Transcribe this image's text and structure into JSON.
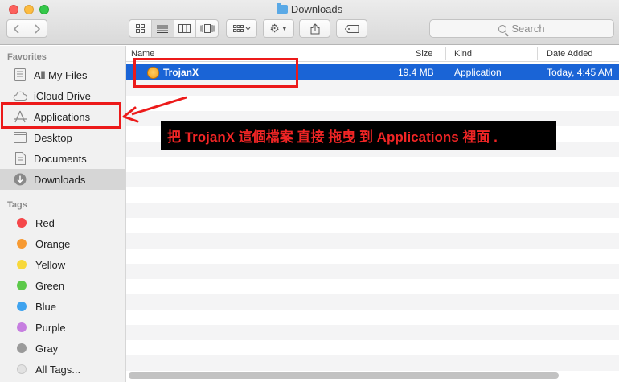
{
  "window": {
    "title": "Downloads"
  },
  "toolbar": {
    "search_placeholder": "Search"
  },
  "sidebar": {
    "favorites_header": "Favorites",
    "favorites": [
      {
        "label": "All My Files",
        "icon": "all-files-icon"
      },
      {
        "label": "iCloud Drive",
        "icon": "cloud-icon"
      },
      {
        "label": "Applications",
        "icon": "applications-icon"
      },
      {
        "label": "Desktop",
        "icon": "desktop-icon"
      },
      {
        "label": "Documents",
        "icon": "documents-icon"
      },
      {
        "label": "Downloads",
        "icon": "downloads-icon",
        "selected": true
      }
    ],
    "tags_header": "Tags",
    "tags": [
      {
        "label": "Red",
        "color": "#f5474a"
      },
      {
        "label": "Orange",
        "color": "#f79a32"
      },
      {
        "label": "Yellow",
        "color": "#f7d83b"
      },
      {
        "label": "Green",
        "color": "#5cc94a"
      },
      {
        "label": "Blue",
        "color": "#3fa3ef"
      },
      {
        "label": "Purple",
        "color": "#c67ee0"
      },
      {
        "label": "Gray",
        "color": "#9a9a9a"
      },
      {
        "label": "All Tags...",
        "color": "#e2e2e2"
      }
    ]
  },
  "list": {
    "columns": {
      "name": "Name",
      "size": "Size",
      "kind": "Kind",
      "date": "Date Added"
    },
    "files": [
      {
        "name": "TrojanX",
        "size": "19.4 MB",
        "kind": "Application",
        "date": "Today, 4:45 AM"
      }
    ]
  },
  "annotation": {
    "text": "把 TrojanX 這個檔案 直接 拖曳 到 Applications 裡面 .",
    "color": "#ec1a1a"
  }
}
